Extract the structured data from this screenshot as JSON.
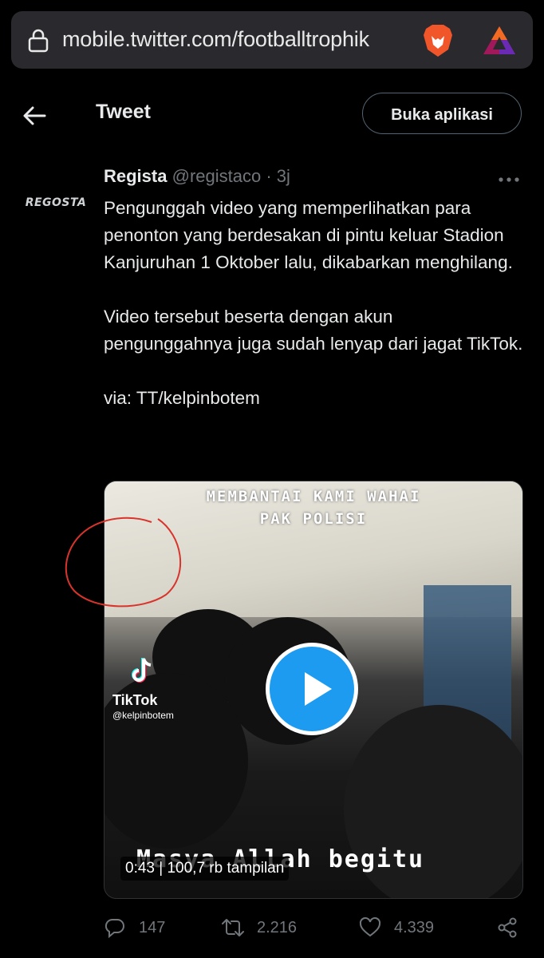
{
  "browser": {
    "url": "mobile.twitter.com/footballtrophik"
  },
  "header": {
    "title": "Tweet",
    "open_app_label": "Buka aplikasi"
  },
  "tweet": {
    "avatar_text": "REGOSTA",
    "author_name": "Regista",
    "author_handle": "@registaco",
    "separator": "·",
    "time": "3j",
    "text": "Pengunggah video yang memperlihatkan para penonton yang berdesakan di pintu keluar Stadion Kanjuruhan 1 Oktober lalu, dikabarkan menghilang.\n\nVideo tersebut beserta dengan akun pengunggahnya juga sudah lenyap dari jagat TikTok.\n\nvia: TT/kelpinbotem"
  },
  "media": {
    "caption_top_line1": "MEMBANTAI KAMI WAHAI",
    "caption_top_line2": "PAK POLISI",
    "caption_bottom": "Masya Allah begitu",
    "tiktok_label": "TikTok",
    "tiktok_handle": "@kelpinbotem",
    "duration": "0:43",
    "views": "100,7 rb tampilan"
  },
  "actions": {
    "replies": "147",
    "retweets": "2.216",
    "likes": "4.339"
  },
  "colors": {
    "background": "#000000",
    "text": "#e7e9ea",
    "muted": "#71767b",
    "accent": "#1d9bf0",
    "annotation": "#d9342b"
  },
  "icons": [
    "lock-icon",
    "brave-lion-icon",
    "brave-rewards-icon",
    "back-arrow-icon",
    "more-icon",
    "tiktok-icon",
    "play-icon",
    "reply-icon",
    "retweet-icon",
    "like-icon",
    "share-icon"
  ]
}
